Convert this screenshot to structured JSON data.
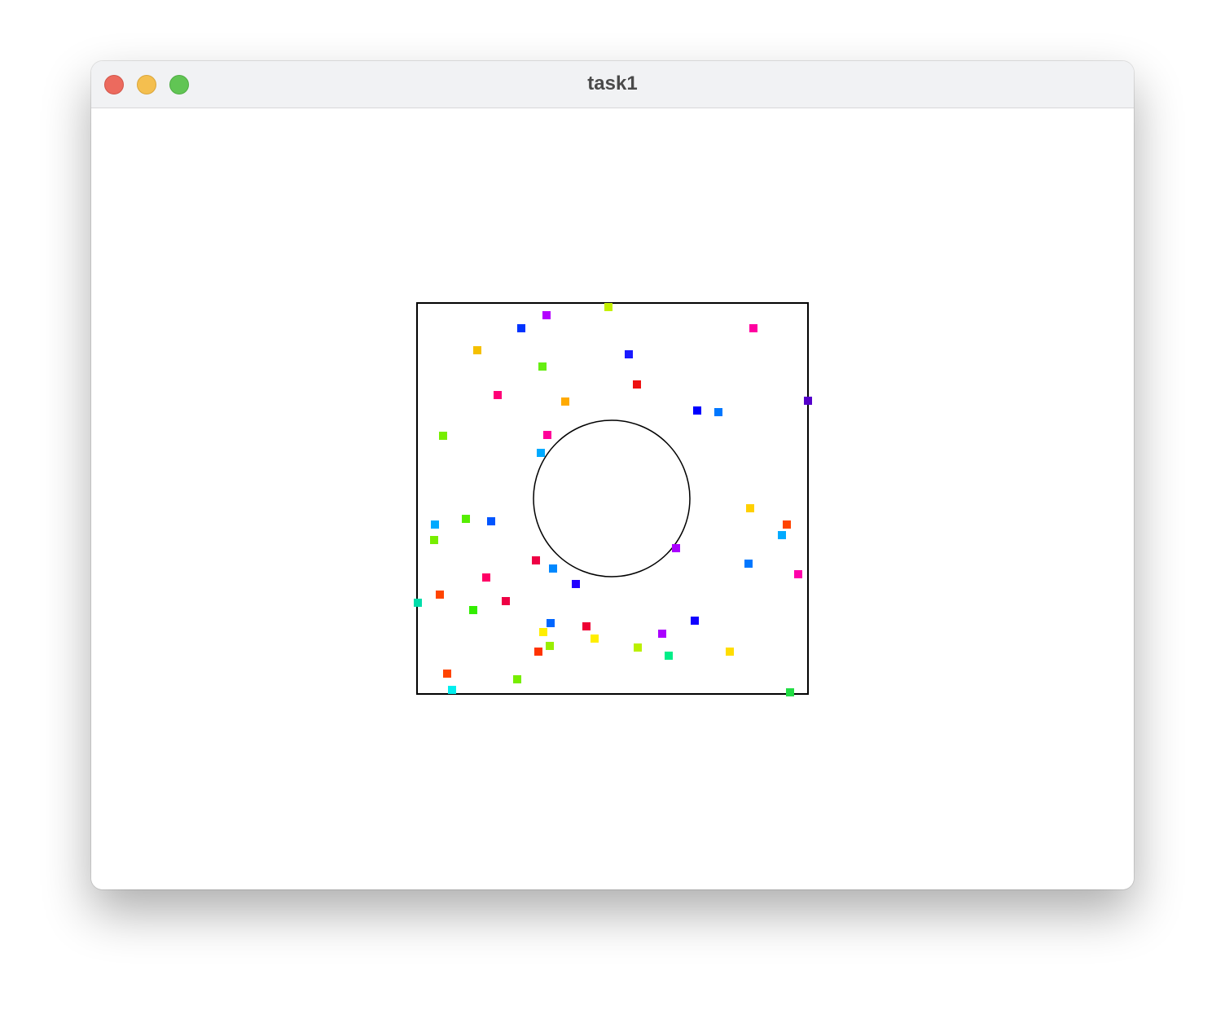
{
  "window": {
    "title": "task1",
    "controls": [
      "close",
      "minimize",
      "zoom"
    ],
    "colors": {
      "close": "#ec6a5e",
      "minimize": "#f4bf4f",
      "zoom": "#61c554",
      "titlebar": "#f1f2f4"
    }
  },
  "scene": {
    "boundary": {
      "shape": "square",
      "stroke": "#000000"
    },
    "obstacle": {
      "shape": "circle",
      "stroke": "#000000"
    },
    "particles": [
      {
        "color": "#c4f000"
      },
      {
        "color": "#b300ff"
      },
      {
        "color": "#0033ff"
      },
      {
        "color": "#ff00a0"
      },
      {
        "color": "#f5c000"
      },
      {
        "color": "#1a1aff"
      },
      {
        "color": "#66ee11"
      },
      {
        "color": "#ee1111"
      },
      {
        "color": "#ff0077"
      },
      {
        "color": "#ffaa00"
      },
      {
        "color": "#0000ff"
      },
      {
        "color": "#0077ff"
      },
      {
        "color": "#5500cc"
      },
      {
        "color": "#77ee00"
      },
      {
        "color": "#ff0099"
      },
      {
        "color": "#00aaff"
      },
      {
        "color": "#ffd000"
      },
      {
        "color": "#ff4400"
      },
      {
        "color": "#00aaff"
      },
      {
        "color": "#55ee00"
      },
      {
        "color": "#0055ff"
      },
      {
        "color": "#00aaff"
      },
      {
        "color": "#77ee00"
      },
      {
        "color": "#aa00ff"
      },
      {
        "color": "#0077ff"
      },
      {
        "color": "#ff00aa"
      },
      {
        "color": "#ee0044"
      },
      {
        "color": "#0088ff"
      },
      {
        "color": "#ff0066"
      },
      {
        "color": "#2200ff"
      },
      {
        "color": "#ff4400"
      },
      {
        "color": "#00ddaa"
      },
      {
        "color": "#ee0044"
      },
      {
        "color": "#33ee00"
      },
      {
        "color": "#0066ff"
      },
      {
        "color": "#ee0033"
      },
      {
        "color": "#1100ff"
      },
      {
        "color": "#ffee00"
      },
      {
        "color": "#ffee00"
      },
      {
        "color": "#aa00ff"
      },
      {
        "color": "#ff3300"
      },
      {
        "color": "#99ee00"
      },
      {
        "color": "#bbf000"
      },
      {
        "color": "#00ee88"
      },
      {
        "color": "#ffdd00"
      },
      {
        "color": "#ff4400"
      },
      {
        "color": "#77ee00"
      },
      {
        "color": "#00eeee"
      },
      {
        "color": "#22dd44"
      }
    ]
  }
}
